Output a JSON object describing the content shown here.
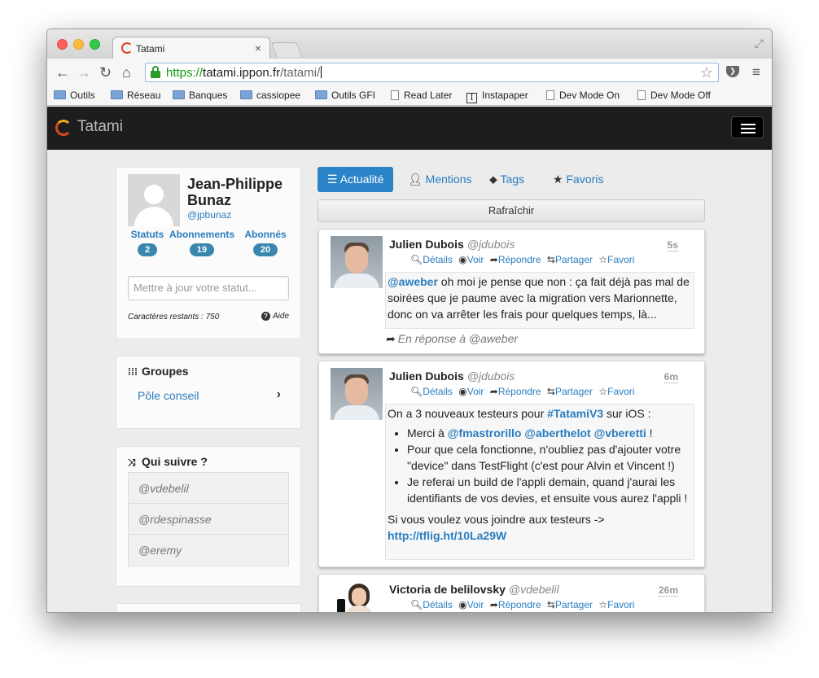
{
  "browser": {
    "tab_title": "Tatami",
    "url_scheme": "https://",
    "url_host": "tatami.ippon.fr",
    "url_path": "/tatami/",
    "bookmarks": [
      "Outils",
      "Réseau",
      "Banques",
      "cassiopee",
      "Outils GFI",
      "Read Later",
      "Instapaper",
      "Dev Mode On",
      "Dev Mode Off"
    ]
  },
  "navbar": {
    "brand": "Tatami"
  },
  "profile": {
    "name": "Jean-Philippe Bunaz",
    "handle": "@jpbunaz",
    "stats": [
      {
        "label": "Statuts",
        "count": "2"
      },
      {
        "label": "Abonnements",
        "count": "19"
      },
      {
        "label": "Abonnés",
        "count": "20"
      }
    ],
    "status_placeholder": "Mettre à jour votre statut...",
    "chars_remaining": "Caractères restants : 750",
    "help": "Aide"
  },
  "groups": {
    "title": "Groupes",
    "items": [
      "Pôle conseil"
    ]
  },
  "who_to_follow": {
    "title": "Qui suivre ?",
    "items": [
      "@vdebelil",
      "@rdespinasse",
      "@eremy"
    ]
  },
  "tabs": [
    "Actualité",
    "Mentions",
    "Tags",
    "Favoris"
  ],
  "refresh_label": "Rafraîchir",
  "actions": [
    "Détails",
    "Voir",
    "Répondre",
    "Partager",
    "Favori"
  ],
  "statuses": [
    {
      "author": "Julien Dubois",
      "handle": "@jdubois",
      "time": "5s",
      "mention": "@aweber",
      "text": " oh moi je pense que non : ça fait déjà pas mal de soirées que je paume avec la migration vers Marionnette, donc on va arrêter les frais pour quelques temps, là...",
      "reply_prefix": "En réponse à ",
      "reply_to": "@aweber"
    },
    {
      "author": "Julien Dubois",
      "handle": "@jdubois",
      "time": "6m",
      "intro_a": "On a 3 nouveaux testeurs pour ",
      "hashtag": "#TatamiV3",
      "intro_b": " sur iOS :",
      "bullet1_a": "Merci à ",
      "bullet1_mentions": "@fmastrorillo @aberthelot @vberetti",
      "bullet1_b": " !",
      "bullet2": "Pour que cela fonctionne, n'oubliez pas d'ajouter votre \"device\" dans TestFlight (c'est pour Alvin et Vincent !)",
      "bullet3": "Je referai un build de l'appli demain, quand j'aurai les identifiants de vos devies, et ensuite vous aurez l'appli !",
      "outro": "Si vous voulez vous joindre aux testeurs ->",
      "link": "http://tflig.ht/10La29W"
    },
    {
      "author": "Victoria de belilovsky",
      "handle": "@vdebelil",
      "time": "26m"
    }
  ]
}
